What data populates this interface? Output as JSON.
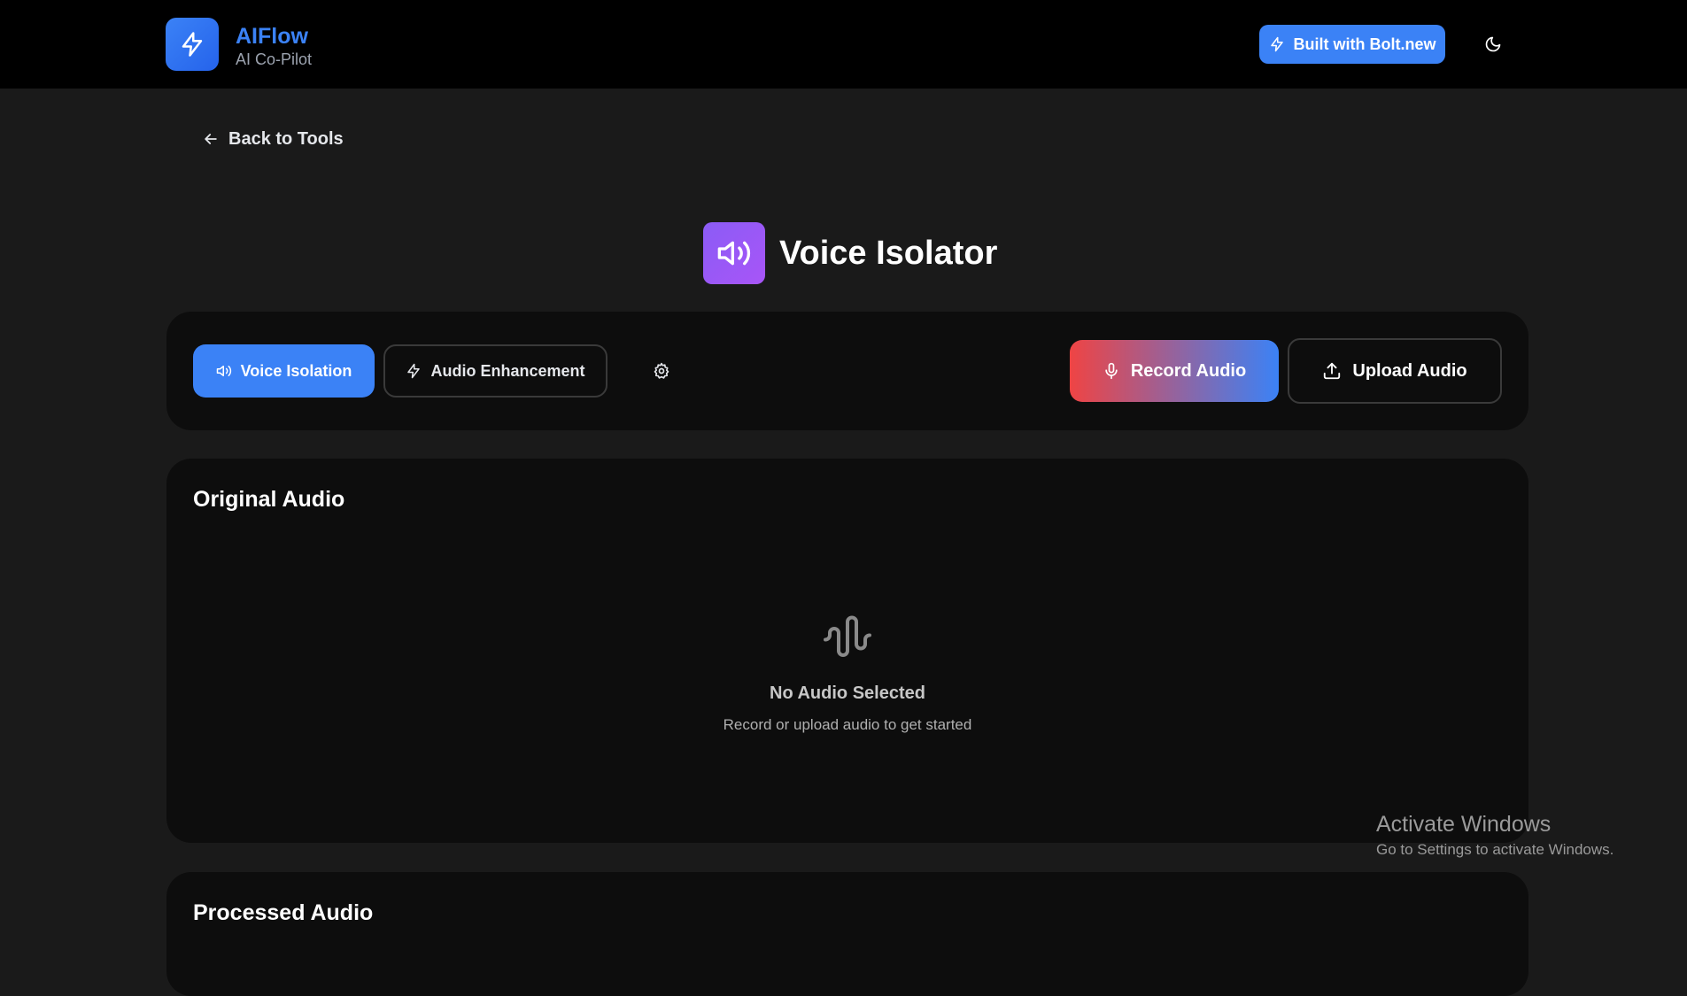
{
  "header": {
    "brand_name": "AIFlow",
    "brand_tagline": "AI Co-Pilot",
    "logo_icon": "bolt-icon",
    "bolt_button_label": "Built with Bolt.new",
    "theme_toggle_icon": "moon-icon"
  },
  "nav": {
    "back_label": "Back to Tools"
  },
  "page": {
    "title": "Voice Isolator",
    "title_icon": "speaker-icon"
  },
  "toolbar": {
    "modes": [
      {
        "label": "Voice Isolation",
        "icon": "speaker-icon",
        "active": true
      },
      {
        "label": "Audio Enhancement",
        "icon": "bolt-icon",
        "active": false
      }
    ],
    "settings_icon": "gear-icon",
    "record_label": "Record Audio",
    "upload_label": "Upload Audio"
  },
  "original_audio": {
    "title": "Original Audio",
    "empty_title": "No Audio Selected",
    "empty_subtitle": "Record or upload audio to get started"
  },
  "processed_audio": {
    "title": "Processed Audio"
  },
  "os_watermark": {
    "title": "Activate Windows",
    "subtitle": "Go to Settings to activate Windows."
  },
  "colors": {
    "accent_blue": "#3b82f6",
    "accent_purple": "#8b5cf6",
    "accent_red": "#ef4444",
    "background": "#1a1a1a",
    "panel": "#0d0d0d",
    "topbar": "#000000"
  }
}
